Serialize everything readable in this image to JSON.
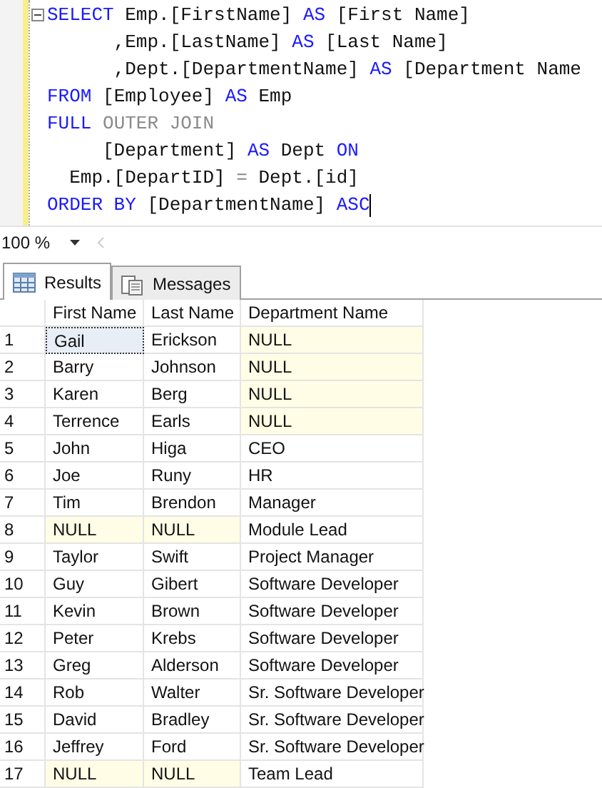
{
  "editor": {
    "lines": [
      {
        "fold_marker": true,
        "caret": false,
        "tokens": [
          {
            "kind": "keyword",
            "text": "SELECT"
          },
          {
            "kind": "text",
            "text": " Emp.[FirstName] "
          },
          {
            "kind": "keyword",
            "text": "AS"
          },
          {
            "kind": "text",
            "text": " [First Name]"
          }
        ]
      },
      {
        "fold_marker": false,
        "caret": false,
        "tokens": [
          {
            "kind": "text",
            "text": "      ,Emp.[LastName] "
          },
          {
            "kind": "keyword",
            "text": "AS"
          },
          {
            "kind": "text",
            "text": " [Last Name]"
          }
        ]
      },
      {
        "fold_marker": false,
        "caret": false,
        "tokens": [
          {
            "kind": "text",
            "text": "      ,Dept.[DepartmentName] "
          },
          {
            "kind": "keyword",
            "text": "AS"
          },
          {
            "kind": "text",
            "text": " [Department Name"
          }
        ]
      },
      {
        "fold_marker": false,
        "caret": false,
        "tokens": [
          {
            "kind": "keyword",
            "text": "FROM"
          },
          {
            "kind": "text",
            "text": " [Employee] "
          },
          {
            "kind": "keyword",
            "text": "AS"
          },
          {
            "kind": "text",
            "text": " Emp"
          }
        ]
      },
      {
        "fold_marker": false,
        "caret": false,
        "tokens": [
          {
            "kind": "keyword",
            "text": "FULL"
          },
          {
            "kind": "operator",
            "text": " OUTER JOIN"
          }
        ]
      },
      {
        "fold_marker": false,
        "caret": false,
        "tokens": [
          {
            "kind": "text",
            "text": "     [Department] "
          },
          {
            "kind": "keyword",
            "text": "AS"
          },
          {
            "kind": "text",
            "text": " Dept "
          },
          {
            "kind": "keyword",
            "text": "ON"
          }
        ]
      },
      {
        "fold_marker": false,
        "caret": false,
        "tokens": [
          {
            "kind": "text",
            "text": "  Emp.[DepartID] "
          },
          {
            "kind": "operator",
            "text": "="
          },
          {
            "kind": "text",
            "text": " Dept.[id]"
          }
        ]
      },
      {
        "fold_marker": false,
        "caret": true,
        "tokens": [
          {
            "kind": "keyword",
            "text": "ORDER BY"
          },
          {
            "kind": "text",
            "text": " [DepartmentName] "
          },
          {
            "kind": "keyword",
            "text": "ASC"
          }
        ]
      }
    ]
  },
  "zoom": {
    "value": "100 %"
  },
  "tabs": [
    {
      "label": "Results",
      "selected": true
    },
    {
      "label": "Messages",
      "selected": false
    }
  ],
  "grid": {
    "columns": [
      "First Name",
      "Last Name",
      "Department Name"
    ],
    "rows": [
      {
        "number": "1",
        "cells": [
          {
            "text": "Gail",
            "kind": "value",
            "selected": true
          },
          {
            "text": "Erickson",
            "kind": "value",
            "selected": false
          },
          {
            "text": "NULL",
            "kind": "null",
            "selected": false
          }
        ]
      },
      {
        "number": "2",
        "cells": [
          {
            "text": "Barry",
            "kind": "value",
            "selected": false
          },
          {
            "text": "Johnson",
            "kind": "value",
            "selected": false
          },
          {
            "text": "NULL",
            "kind": "null",
            "selected": false
          }
        ]
      },
      {
        "number": "3",
        "cells": [
          {
            "text": "Karen",
            "kind": "value",
            "selected": false
          },
          {
            "text": "Berg",
            "kind": "value",
            "selected": false
          },
          {
            "text": "NULL",
            "kind": "null",
            "selected": false
          }
        ]
      },
      {
        "number": "4",
        "cells": [
          {
            "text": "Terrence",
            "kind": "value",
            "selected": false
          },
          {
            "text": "Earls",
            "kind": "value",
            "selected": false
          },
          {
            "text": "NULL",
            "kind": "null",
            "selected": false
          }
        ]
      },
      {
        "number": "5",
        "cells": [
          {
            "text": "John",
            "kind": "value",
            "selected": false
          },
          {
            "text": "Higa",
            "kind": "value",
            "selected": false
          },
          {
            "text": "CEO",
            "kind": "value",
            "selected": false
          }
        ]
      },
      {
        "number": "6",
        "cells": [
          {
            "text": "Joe",
            "kind": "value",
            "selected": false
          },
          {
            "text": "Runy",
            "kind": "value",
            "selected": false
          },
          {
            "text": "HR",
            "kind": "value",
            "selected": false
          }
        ]
      },
      {
        "number": "7",
        "cells": [
          {
            "text": "Tim",
            "kind": "value",
            "selected": false
          },
          {
            "text": "Brendon",
            "kind": "value",
            "selected": false
          },
          {
            "text": "Manager",
            "kind": "value",
            "selected": false
          }
        ]
      },
      {
        "number": "8",
        "cells": [
          {
            "text": "NULL",
            "kind": "null",
            "selected": false
          },
          {
            "text": "NULL",
            "kind": "null",
            "selected": false
          },
          {
            "text": "Module Lead",
            "kind": "value",
            "selected": false
          }
        ]
      },
      {
        "number": "9",
        "cells": [
          {
            "text": "Taylor",
            "kind": "value",
            "selected": false
          },
          {
            "text": "Swift",
            "kind": "value",
            "selected": false
          },
          {
            "text": "Project Manager",
            "kind": "value",
            "selected": false
          }
        ]
      },
      {
        "number": "10",
        "cells": [
          {
            "text": "Guy",
            "kind": "value",
            "selected": false
          },
          {
            "text": "Gibert",
            "kind": "value",
            "selected": false
          },
          {
            "text": "Software Developer",
            "kind": "value",
            "selected": false
          }
        ]
      },
      {
        "number": "11",
        "cells": [
          {
            "text": "Kevin",
            "kind": "value",
            "selected": false
          },
          {
            "text": "Brown",
            "kind": "value",
            "selected": false
          },
          {
            "text": "Software Developer",
            "kind": "value",
            "selected": false
          }
        ]
      },
      {
        "number": "12",
        "cells": [
          {
            "text": "Peter",
            "kind": "value",
            "selected": false
          },
          {
            "text": "Krebs",
            "kind": "value",
            "selected": false
          },
          {
            "text": "Software Developer",
            "kind": "value",
            "selected": false
          }
        ]
      },
      {
        "number": "13",
        "cells": [
          {
            "text": "Greg",
            "kind": "value",
            "selected": false
          },
          {
            "text": "Alderson",
            "kind": "value",
            "selected": false
          },
          {
            "text": "Software Developer",
            "kind": "value",
            "selected": false
          }
        ]
      },
      {
        "number": "14",
        "cells": [
          {
            "text": "Rob",
            "kind": "value",
            "selected": false
          },
          {
            "text": "Walter",
            "kind": "value",
            "selected": false
          },
          {
            "text": "Sr. Software Developer",
            "kind": "value",
            "selected": false
          }
        ]
      },
      {
        "number": "15",
        "cells": [
          {
            "text": "David",
            "kind": "value",
            "selected": false
          },
          {
            "text": "Bradley",
            "kind": "value",
            "selected": false
          },
          {
            "text": "Sr. Software Developer",
            "kind": "value",
            "selected": false
          }
        ]
      },
      {
        "number": "16",
        "cells": [
          {
            "text": "Jeffrey",
            "kind": "value",
            "selected": false
          },
          {
            "text": "Ford",
            "kind": "value",
            "selected": false
          },
          {
            "text": "Sr. Software Developer",
            "kind": "value",
            "selected": false
          }
        ]
      },
      {
        "number": "17",
        "cells": [
          {
            "text": "NULL",
            "kind": "null",
            "selected": false
          },
          {
            "text": "NULL",
            "kind": "null",
            "selected": false
          },
          {
            "text": "Team Lead",
            "kind": "value",
            "selected": false
          }
        ]
      }
    ]
  }
}
